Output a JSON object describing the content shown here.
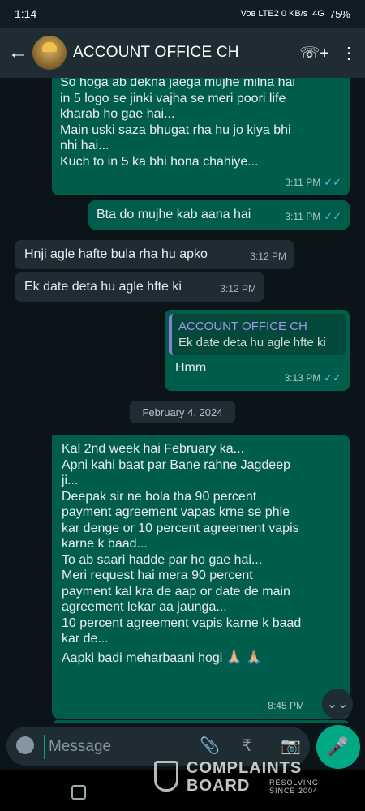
{
  "status": {
    "time": "1:14",
    "network": "Voʙ LTE2  0 KB/s",
    "signal": "4G",
    "battery": "75%"
  },
  "header": {
    "back": "←",
    "title": "ACCOUNT OFFICE CH",
    "call_icon": "☏+",
    "menu_icon": "⋮"
  },
  "messages": [
    {
      "type": "out",
      "lines": [
        "So hoga ab dekna jaega mujhe milna hai",
        "in 5 logo se jinki vajha se meri poori life",
        "kharab ho gae hai...",
        "Main uski saza bhugat rha hu jo kiya bhi",
        "nhi hai...",
        "Kuch to in 5  ka bhi hona chahiye..."
      ],
      "time": "3:11 PM",
      "ticks": "✓✓"
    },
    {
      "type": "out",
      "lines": [
        "Bta do mujhe kab aana hai"
      ],
      "time": "3:11 PM",
      "ticks": "✓✓"
    },
    {
      "type": "in",
      "lines": [
        "Hnji agle hafte bula rha hu apko"
      ],
      "time": "3:12 PM"
    },
    {
      "type": "in",
      "lines": [
        "Ek date deta hu agle hfte ki"
      ],
      "time": "3:12 PM"
    },
    {
      "type": "out",
      "quote_name": "ACCOUNT OFFICE CH",
      "quote_text": "Ek date deta hu agle hfte ki",
      "lines": [
        "Hmm"
      ],
      "time": "3:13 PM",
      "ticks": "✓✓"
    },
    {
      "type": "out",
      "lines": [
        "Kal 2nd week hai February ka...",
        "Apni kahi baat par Bane rahne Jagdeep",
        "ji...",
        "Deepak sir ne bola tha 90 percent",
        "payment agreement vapas krne se phle",
        "kar denge or 10 percent agreement vapis",
        "karne k baad...",
        "To ab saari hadde par ho gae hai...",
        "Meri request hai mera 90 percent",
        "payment kal kra de aap or date de main",
        "agreement lekar aa jaunga...",
        "10 percent agreement vapis karne k baad",
        "kar de...",
        "Aapki badi meharbaani hogi 🙏🏼 🙏🏼"
      ],
      "time": "8:45 PM"
    }
  ],
  "date_chip": "February 4, 2024",
  "scroll_icon": "⌄⌄",
  "input": {
    "placeholder": "Message",
    "emoji_icon": "emoji-icon",
    "attach_icon": "📎",
    "rupee_icon": "₹",
    "camera_icon": "📷",
    "mic_icon": "🎤"
  },
  "watermark": {
    "line1": "COMPLAINTS",
    "line2": "BOARD",
    "line3": "RESOLVING SINCE 2004"
  }
}
